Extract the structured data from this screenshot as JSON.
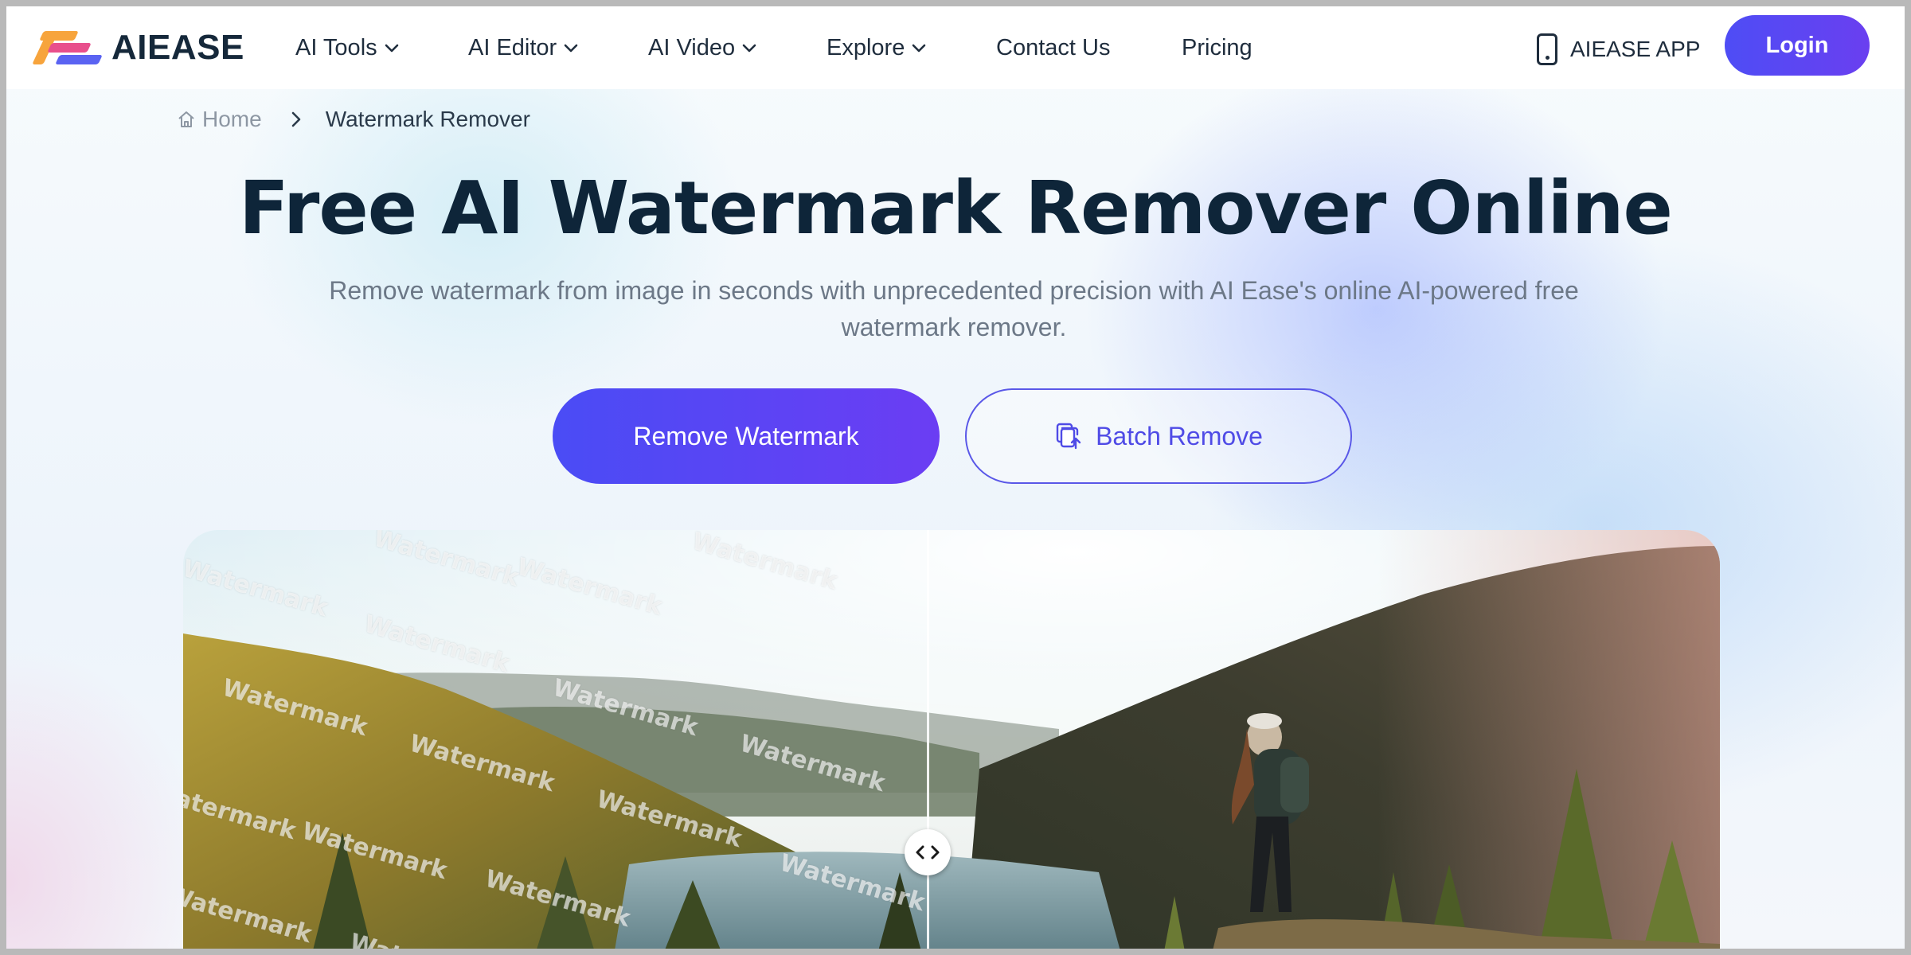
{
  "brand": {
    "name": "AIEASE"
  },
  "nav": {
    "items": [
      {
        "label": "AI Tools",
        "dropdown": true
      },
      {
        "label": "AI Editor",
        "dropdown": true
      },
      {
        "label": "AI Video",
        "dropdown": true
      },
      {
        "label": "Explore",
        "dropdown": true
      },
      {
        "label": "Contact Us",
        "dropdown": false
      },
      {
        "label": "Pricing",
        "dropdown": false
      }
    ],
    "app_label": "AIEASE APP",
    "login_label": "Login"
  },
  "breadcrumb": {
    "home": "Home",
    "current": "Watermark Remover"
  },
  "hero": {
    "title": "Free AI Watermark Remover Online",
    "subtitle": "Remove watermark from image in seconds with unprecedented precision with AI Ease's online AI-powered free watermark remover.",
    "primary_button": "Remove Watermark",
    "secondary_button": "Batch Remove"
  },
  "comparison": {
    "watermark_text": "Watermark",
    "handle_icon": "left-right-arrows-icon"
  },
  "colors": {
    "accent": "#4e4df5",
    "accent_end": "#6b3df3",
    "heading": "#0e2539",
    "subtext": "#6c7887"
  }
}
